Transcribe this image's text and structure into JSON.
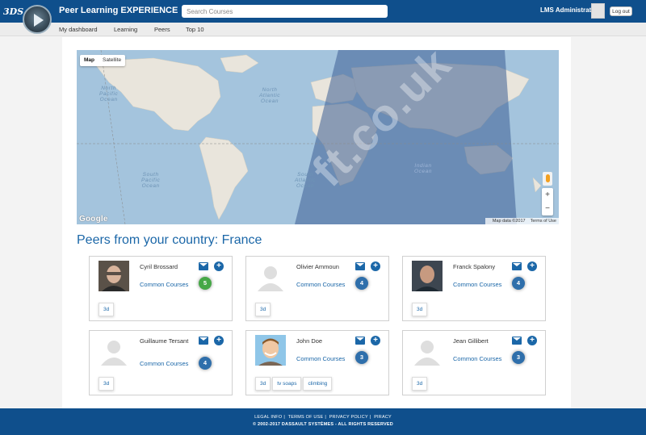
{
  "header": {
    "brand_logo": "3DS",
    "app_title": "Peer Learning EXPERIENCE",
    "search_placeholder": "Search Courses",
    "user_name": "LMS Administrator",
    "logout_label": "Log out"
  },
  "nav": {
    "items": [
      "My dashboard",
      "Learning",
      "Peers",
      "Top 10"
    ]
  },
  "map": {
    "type_options": [
      "Map",
      "Satellite"
    ],
    "selected_type": "Map",
    "zoom_in": "+",
    "zoom_out": "−",
    "logo": "Google",
    "map_data": "Map data ©2017",
    "terms": "Terms of Use",
    "watermark": "ft.co.uk",
    "oceans": {
      "north_pacific": "North\nPacific\nOcean",
      "north_atlantic": "North\nAtlantic\nOcean",
      "south_pacific": "South\nPacific\nOcean",
      "south_atlantic": "South\nAtlantic\nOcean",
      "indian": "Indian\nOcean"
    },
    "colors": {
      "water": "#a4c4dd",
      "land": "#e9e5dc",
      "night": "#3c5f93"
    }
  },
  "section_title": "Peers from your country: France",
  "common_courses_label": "Common Courses",
  "peers": [
    {
      "name": "Cyril Brossard",
      "count": "5",
      "tags": [
        "3d"
      ]
    },
    {
      "name": "Olivier Ammoun",
      "count": "4",
      "tags": [
        "3d"
      ]
    },
    {
      "name": "Franck Spalony",
      "count": "4",
      "tags": [
        "3d"
      ]
    },
    {
      "name": "Guillaume Tersant",
      "count": "4",
      "tags": [
        "3d"
      ]
    },
    {
      "name": "John Doe",
      "count": "3",
      "tags": [
        "3d",
        "tv soaps",
        "climbing"
      ]
    },
    {
      "name": "Jean Gillibert",
      "count": "3",
      "tags": [
        "3d"
      ]
    }
  ],
  "footer": {
    "links": [
      "LEGAL INFO",
      "TERMS OF USE",
      "PRIVACY POLICY",
      "PIRACY"
    ],
    "copyright": "© 2002-2017 DASSAULT SYSTÈMES - ALL RIGHTS RESERVED"
  }
}
